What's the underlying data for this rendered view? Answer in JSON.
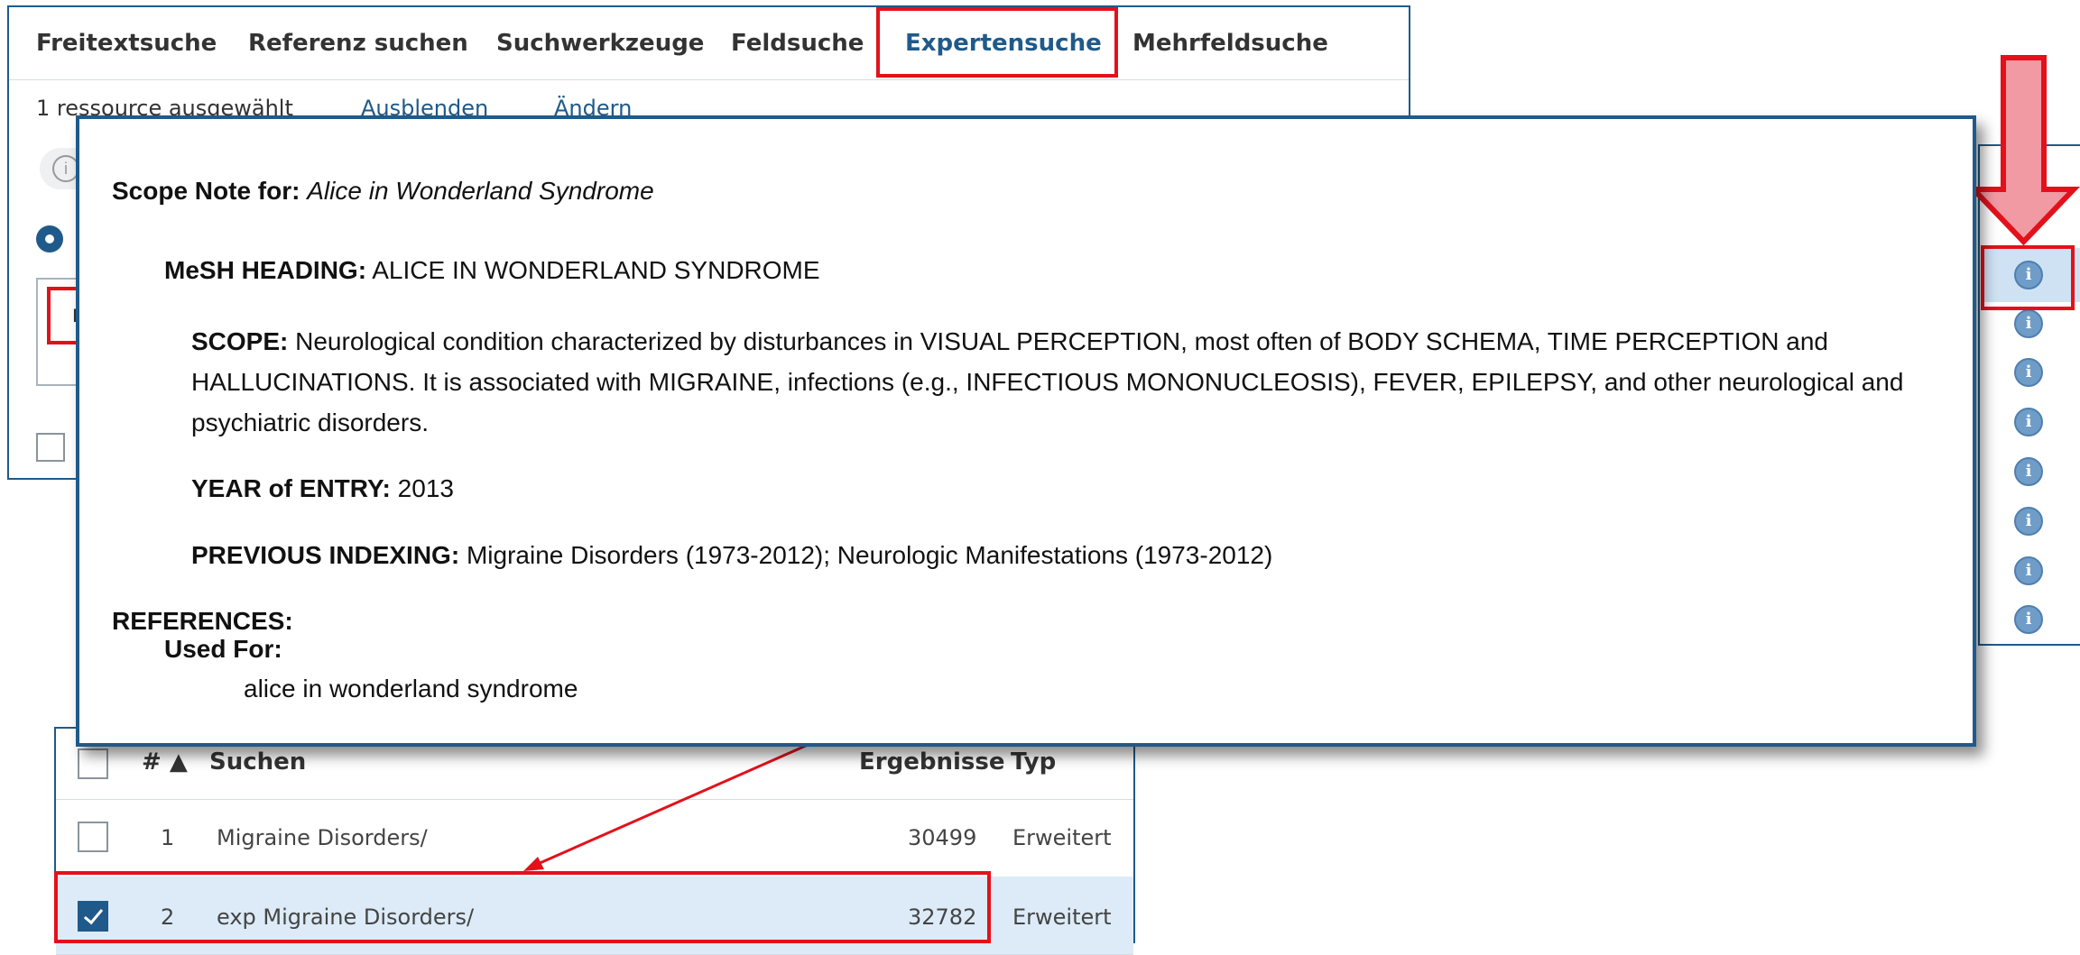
{
  "tabs": [
    {
      "label": "Freitextsuche"
    },
    {
      "label": "Referenz suchen"
    },
    {
      "label": "Suchwerkzeuge"
    },
    {
      "label": "Feldsuche"
    },
    {
      "label": "Expertensuche"
    },
    {
      "label": "Mehrfeldsuche"
    }
  ],
  "active_tab": "Expertensuche",
  "resource_bar": {
    "selected_text": "1 ressource ausgewählt",
    "hide_link": "Ausblenden",
    "change_link": "Ändern"
  },
  "search_input": {
    "partial_value": "r"
  },
  "scope_note": {
    "title_label": "Scope Note for:",
    "title_value": "Alice in Wonderland Syndrome",
    "heading_label": "MeSH HEADING:",
    "heading_value": "ALICE IN WONDERLAND SYNDROME",
    "scope_label": "SCOPE:",
    "scope_value": "Neurological condition characterized by disturbances in VISUAL PERCEPTION, most often of BODY SCHEMA, TIME PERCEPTION and HALLUCINATIONS. It is associated with MIGRAINE, infections (e.g., INFECTIOUS MONONUCLEOSIS), FEVER, EPILEPSY, and other neurological and psychiatric disorders.",
    "year_label": "YEAR of ENTRY:",
    "year_value": "2013",
    "prev_label": "PREVIOUS INDEXING:",
    "prev_value": "Migraine Disorders (1973-2012); Neurologic Manifestations (1973-2012)",
    "references_label": "REFERENCES:",
    "used_for_label": "Used For:",
    "used_for_value": "alice in wonderland syndrome"
  },
  "info_icon_glyph": "i",
  "results_table": {
    "headers": {
      "num": "# ▲",
      "search": "Suchen",
      "results": "Ergebnisse",
      "type": "Typ"
    },
    "rows": [
      {
        "num": "1",
        "search": "Migraine Disorders/",
        "results": "30499",
        "type": "Erweitert",
        "checked": false
      },
      {
        "num": "2",
        "search": "exp Migraine Disorders/",
        "results": "32782",
        "type": "Erweitert",
        "checked": true
      }
    ]
  },
  "colors": {
    "accent": "#1f5a8a",
    "highlight_red": "#e3111b",
    "selected_row": "#dcebf7",
    "info_icon": "#6f9dc8"
  }
}
